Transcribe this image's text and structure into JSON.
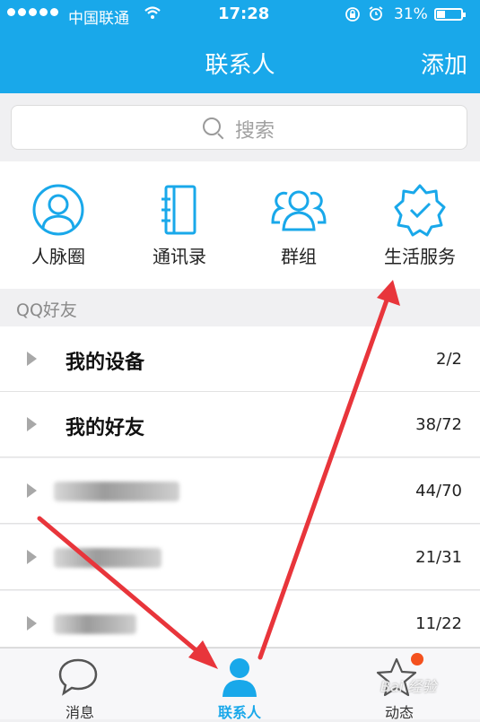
{
  "status_bar": {
    "carrier": "中国联通",
    "time": "17:28",
    "battery": "31%"
  },
  "nav": {
    "title": "联系人",
    "add": "添加"
  },
  "search": {
    "placeholder": "搜索"
  },
  "quick_entries": [
    {
      "label": "人脉圈",
      "icon": "person-circle-icon"
    },
    {
      "label": "通讯录",
      "icon": "address-book-icon"
    },
    {
      "label": "群组",
      "icon": "group-icon"
    },
    {
      "label": "生活服务",
      "icon": "badge-check-icon"
    }
  ],
  "group_header": "QQ好友",
  "friend_groups": [
    {
      "name": "我的设备",
      "count": "2/2"
    },
    {
      "name": "我的好友",
      "count": "38/72"
    },
    {
      "name": "",
      "count": "44/70"
    },
    {
      "name": "",
      "count": "21/31"
    },
    {
      "name": "",
      "count": "11/22"
    }
  ],
  "tabs": [
    {
      "label": "消息",
      "icon": "chat-bubble-icon"
    },
    {
      "label": "联系人",
      "icon": "contact-person-icon"
    },
    {
      "label": "动态",
      "icon": "star-icon"
    }
  ],
  "colors": {
    "accent": "#19a8ea",
    "annotation_arrow": "#e8353b",
    "badge": "#f4511e"
  },
  "watermark": "Bai 经验"
}
